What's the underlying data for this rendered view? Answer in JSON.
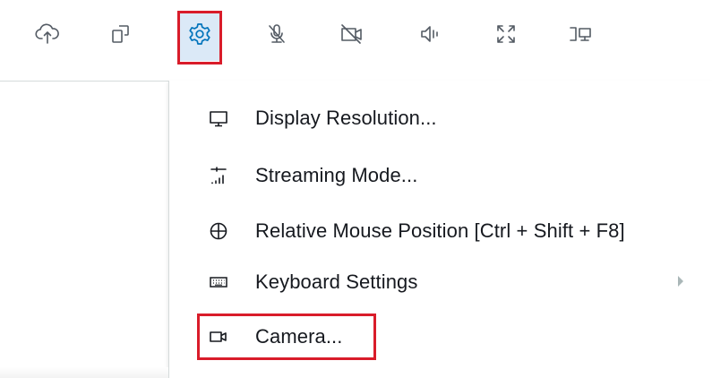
{
  "toolbar": {
    "buttons": [
      {
        "icon": "cloud-upload-icon",
        "active": false
      },
      {
        "icon": "rotate-device-icon",
        "active": false
      },
      {
        "icon": "gear-icon",
        "active": true
      },
      {
        "icon": "microphone-muted-icon",
        "active": false
      },
      {
        "icon": "video-camera-off-icon",
        "active": false
      },
      {
        "icon": "speaker-icon",
        "active": false
      },
      {
        "icon": "fullscreen-icon",
        "active": false
      },
      {
        "icon": "dual-monitor-icon",
        "active": false
      }
    ],
    "accent_color": "#0073bb",
    "highlight_color": "#d91c2a"
  },
  "settings_menu": {
    "items": [
      {
        "label": "Display Resolution...",
        "icon": "monitor-icon"
      },
      {
        "label": "Streaming Mode...",
        "icon": "signal-bars-icon"
      },
      {
        "label": "Relative Mouse Position [Ctrl + Shift + F8]",
        "icon": "crosshair-icon"
      },
      {
        "label": "Keyboard Settings",
        "icon": "keyboard-icon",
        "has_submenu": true
      },
      {
        "label": "Camera...",
        "icon": "camera-icon",
        "highlighted": true
      }
    ]
  }
}
